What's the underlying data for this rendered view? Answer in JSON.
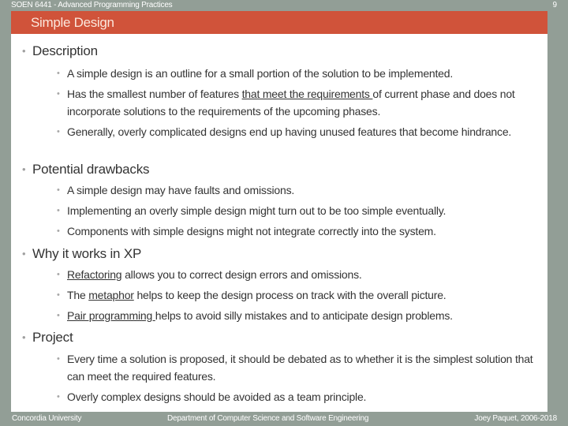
{
  "header": {
    "course": "SOEN 6441 - Advanced Programming Practices",
    "page_number": "9",
    "title": "Simple Design"
  },
  "colors": {
    "frame": "#929e96",
    "title_bar": "#d0533a",
    "title_text": "#fbe7dc",
    "body_text": "#333333"
  },
  "sections": [
    {
      "heading": "Description",
      "bullets": [
        {
          "parts": [
            {
              "text": "A simple design is an outline for a small portion of the solution to be implemented.",
              "u": false
            }
          ]
        },
        {
          "parts": [
            {
              "text": "Has the smallest number of features ",
              "u": false
            },
            {
              "text": "that meet the requirements ",
              "u": true
            },
            {
              "text": "of current phase and does not incorporate solutions to the requirements of the upcoming phases.",
              "u": false
            }
          ]
        },
        {
          "parts": [
            {
              "text": "Generally, overly complicated designs end up having unused features that become hindrance.",
              "u": false
            }
          ]
        }
      ]
    },
    {
      "heading": "Potential drawbacks",
      "bullets": [
        {
          "parts": [
            {
              "text": "A simple design may have faults and omissions.",
              "u": false
            }
          ]
        },
        {
          "parts": [
            {
              "text": "Implementing an overly simple design might turn out to be too simple eventually.",
              "u": false
            }
          ]
        },
        {
          "parts": [
            {
              "text": "Components with simple designs might not integrate correctly into the system.",
              "u": false
            }
          ]
        }
      ]
    },
    {
      "heading": "Why it works in XP",
      "bullets": [
        {
          "parts": [
            {
              "text": "Refactoring",
              "u": true
            },
            {
              "text": " allows you to correct design errors and omissions.",
              "u": false
            }
          ]
        },
        {
          "parts": [
            {
              "text": "The ",
              "u": false
            },
            {
              "text": "metaphor",
              "u": true
            },
            {
              "text": " helps to keep the design process on track with the overall picture.",
              "u": false
            }
          ]
        },
        {
          "parts": [
            {
              "text": "Pair programming ",
              "u": true
            },
            {
              "text": "helps to avoid silly mistakes and to anticipate design problems.",
              "u": false
            }
          ]
        }
      ]
    },
    {
      "heading": "Project",
      "bullets": [
        {
          "parts": [
            {
              "text": "Every time a solution is proposed, it should be debated as to whether it is the simplest solution that can meet the required features.",
              "u": false
            }
          ]
        },
        {
          "parts": [
            {
              "text": "Overly complex designs should be avoided as a team principle.",
              "u": false
            }
          ]
        }
      ]
    }
  ],
  "footer": {
    "left": "Concordia University",
    "center": "Department of Computer Science and Software Engineering",
    "right": "Joey Paquet, 2006-2018"
  }
}
